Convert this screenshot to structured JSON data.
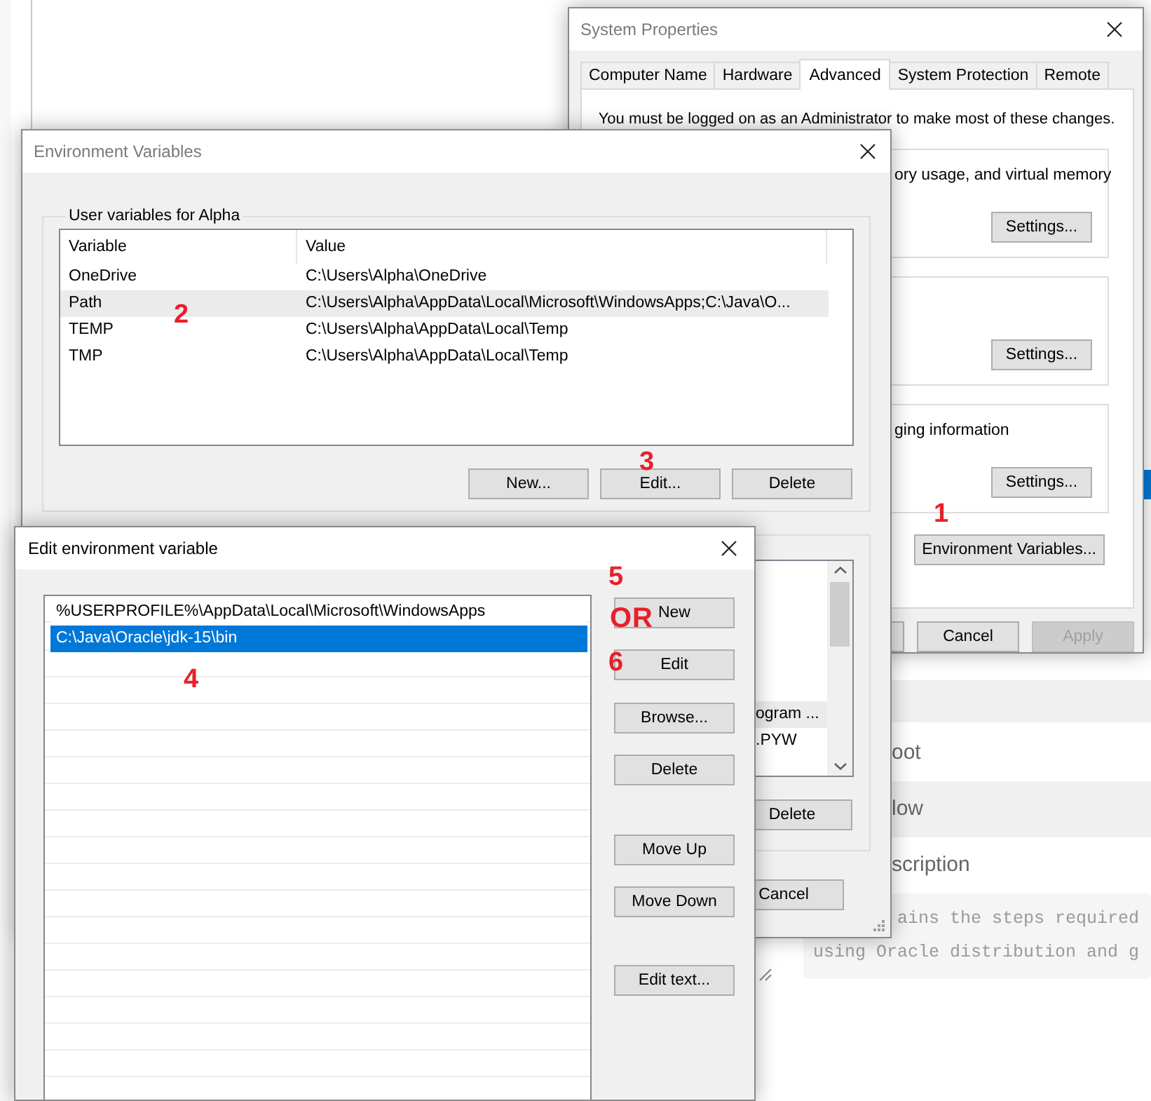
{
  "background_page": {
    "headings": [
      "oot",
      "low",
      "scription"
    ],
    "code_lines": [
      "ains the steps required",
      "using Oracle distribution and g"
    ]
  },
  "system_properties": {
    "title": "System Properties",
    "active": false,
    "tabs": [
      {
        "label": "Computer Name",
        "selected": false
      },
      {
        "label": "Hardware",
        "selected": false
      },
      {
        "label": "Advanced",
        "selected": true
      },
      {
        "label": "System Protection",
        "selected": false
      },
      {
        "label": "Remote",
        "selected": false
      }
    ],
    "notice": "You must be logged on as an Administrator to make most of these changes.",
    "groups": [
      {
        "text": "ory usage, and virtual memory",
        "button": "Settings..."
      },
      {
        "button": "Settings..."
      },
      {
        "text": "ging information",
        "button": "Settings..."
      }
    ],
    "environment_button": "Environment Variables...",
    "buttons": [
      {
        "label": "Cancel",
        "disabled": false
      },
      {
        "label": "Apply",
        "disabled": true
      }
    ]
  },
  "environment_variables": {
    "title": "Environment Variables",
    "active": false,
    "user_variables": {
      "title": "User variables for Alpha",
      "columns": [
        "Variable",
        "Value"
      ],
      "rows": [
        {
          "variable": "OneDrive",
          "value": "C:\\Users\\Alpha\\OneDrive",
          "highlighted": false
        },
        {
          "variable": "Path",
          "value": "C:\\Users\\Alpha\\AppData\\Local\\Microsoft\\WindowsApps;C:\\Java\\O...",
          "highlighted": true
        },
        {
          "variable": "TEMP",
          "value": "C:\\Users\\Alpha\\AppData\\Local\\Temp",
          "highlighted": false
        },
        {
          "variable": "TMP",
          "value": "C:\\Users\\Alpha\\AppData\\Local\\Temp",
          "highlighted": false
        }
      ],
      "buttons": [
        "New...",
        "Edit...",
        "Delete"
      ]
    },
    "system_variables": {
      "rows": [
        {
          "text": "ogram ...",
          "highlighted": true
        },
        {
          "text": ".PYW",
          "highlighted": false
        }
      ],
      "buttons": [
        "Delete"
      ]
    },
    "buttons": [
      "Cancel"
    ]
  },
  "edit_environment_variable": {
    "title": "Edit environment variable",
    "active": true,
    "entries": [
      {
        "text": "%USERPROFILE%\\AppData\\Local\\Microsoft\\WindowsApps",
        "selected": false
      },
      {
        "text": "C:\\Java\\Oracle\\jdk-15\\bin",
        "selected": true
      }
    ],
    "buttons": [
      "New",
      "Edit",
      "Browse...",
      "Delete",
      "Move Up",
      "Move Down",
      "Edit text..."
    ]
  },
  "annotations": [
    {
      "text": "1",
      "kind": "number"
    },
    {
      "text": "2",
      "kind": "number"
    },
    {
      "text": "3",
      "kind": "number"
    },
    {
      "text": "4",
      "kind": "number"
    },
    {
      "text": "5",
      "kind": "number"
    },
    {
      "text": "OR",
      "kind": "word"
    },
    {
      "text": "6",
      "kind": "number"
    }
  ]
}
